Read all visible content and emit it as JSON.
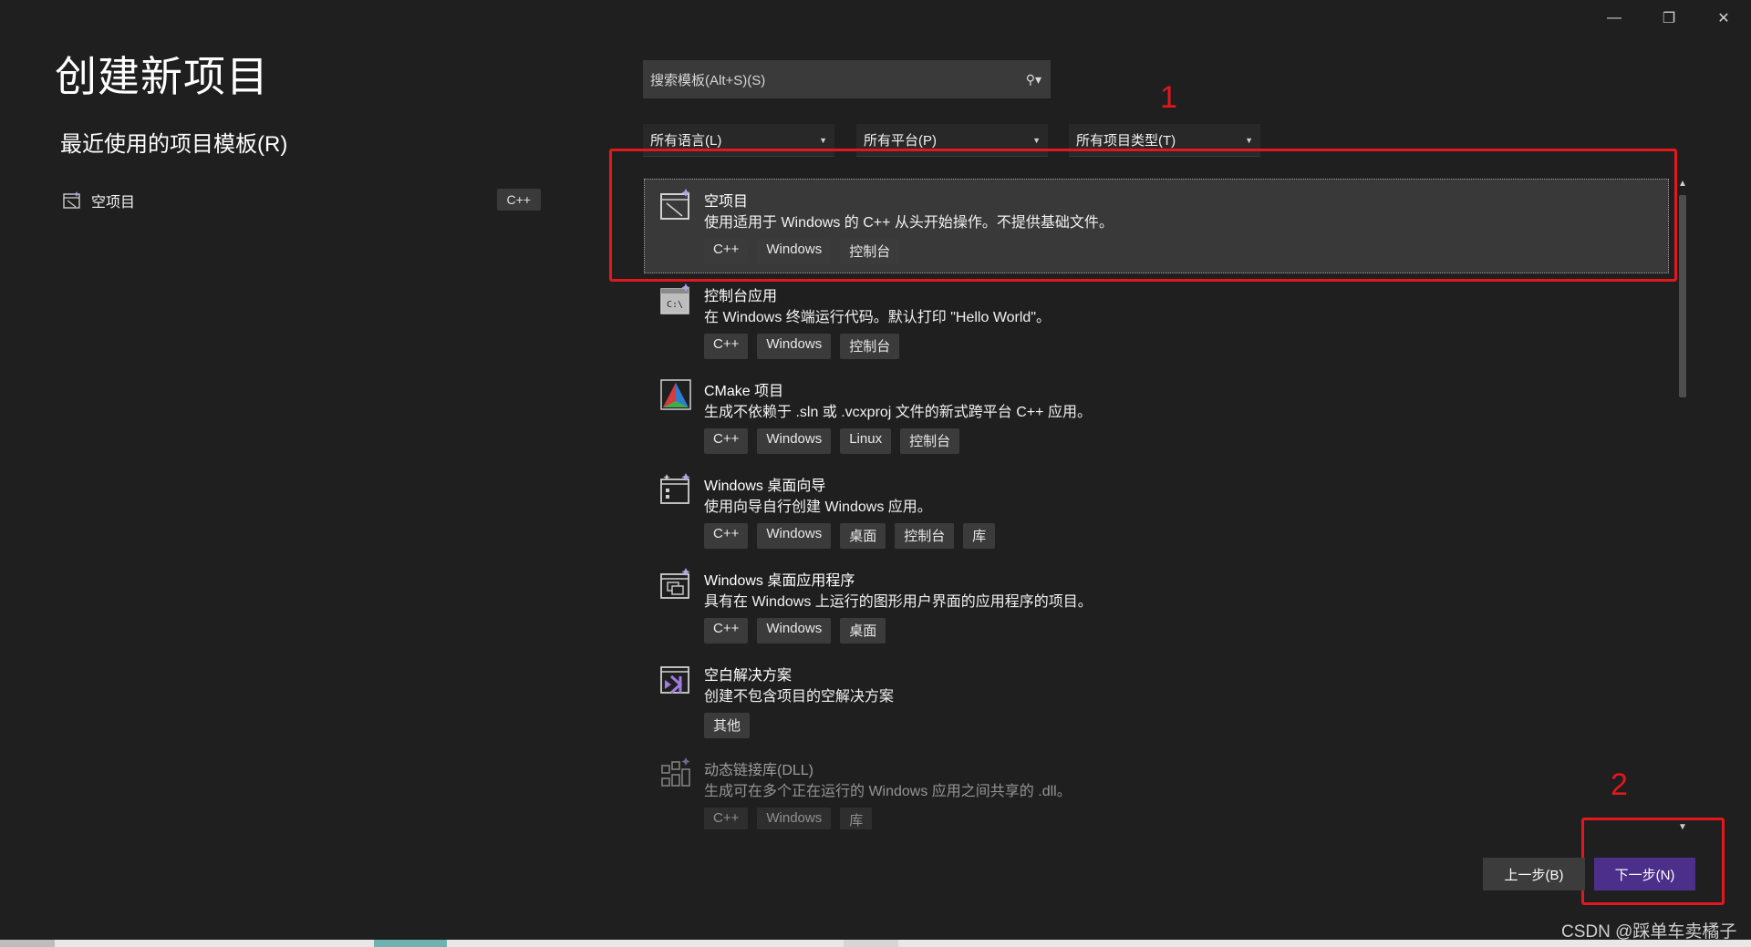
{
  "window": {
    "minimize_icon": "minimize-icon",
    "restore_icon": "restore-icon",
    "close_icon": "close-icon",
    "minimize_glyph": "—",
    "restore_glyph": "❐",
    "close_glyph": "✕"
  },
  "page": {
    "title": "创建新项目",
    "recent_title": "最近使用的项目模板(R)"
  },
  "recent": {
    "items": [
      {
        "label": "空项目",
        "tag": "C++"
      }
    ]
  },
  "search": {
    "placeholder": "搜索模板(Alt+S)(S)",
    "icon_glyph": "⚲▾"
  },
  "filters": {
    "language": "所有语言(L)",
    "platform": "所有平台(P)",
    "project_type": "所有项目类型(T)",
    "caret": "▼"
  },
  "templates": [
    {
      "name": "空项目",
      "description": "使用适用于 Windows 的 C++ 从头开始操作。不提供基础文件。",
      "tags": [
        "C++",
        "Windows",
        "控制台"
      ],
      "selected": true
    },
    {
      "name": "控制台应用",
      "description": "在 Windows 终端运行代码。默认打印 \"Hello World\"。",
      "tags": [
        "C++",
        "Windows",
        "控制台"
      ]
    },
    {
      "name": "CMake 项目",
      "description": "生成不依赖于 .sln 或 .vcxproj 文件的新式跨平台 C++ 应用。",
      "tags": [
        "C++",
        "Windows",
        "Linux",
        "控制台"
      ]
    },
    {
      "name": "Windows 桌面向导",
      "description": "使用向导自行创建 Windows 应用。",
      "tags": [
        "C++",
        "Windows",
        "桌面",
        "控制台",
        "库"
      ]
    },
    {
      "name": "Windows 桌面应用程序",
      "description": "具有在 Windows 上运行的图形用户界面的应用程序的项目。",
      "tags": [
        "C++",
        "Windows",
        "桌面"
      ]
    },
    {
      "name": "空白解决方案",
      "description": "创建不包含项目的空解决方案",
      "tags": [
        "其他"
      ]
    },
    {
      "name": "动态链接库(DLL)",
      "description": "生成可在多个正在运行的 Windows 应用之间共享的 .dll。",
      "tags": [
        "C++",
        "Windows",
        "库"
      ]
    }
  ],
  "scrollbar": {
    "up": "▲",
    "down": "▼"
  },
  "annotations": {
    "mark1": "1",
    "mark2": "2"
  },
  "buttons": {
    "back": "上一步(B)",
    "next": "下一步(N)"
  },
  "watermark": "CSDN @踩单车卖橘子",
  "colors": {
    "accent": "#4b2f8a",
    "highlight": "#e2181e",
    "background": "#1f1f1f"
  }
}
